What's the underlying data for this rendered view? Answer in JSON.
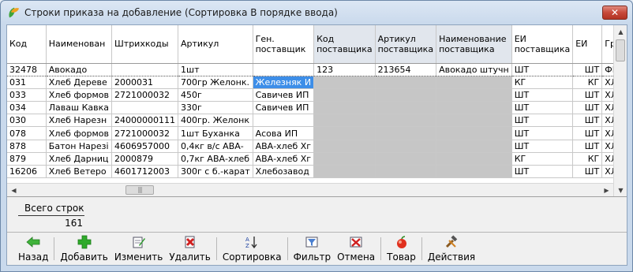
{
  "window": {
    "title": "Строки приказа на добавление (Сортировка В порядке ввода)",
    "close_label": "✕"
  },
  "grid": {
    "columns": [
      {
        "label": "Код",
        "w": 70,
        "sel": false
      },
      {
        "label": "Наименован",
        "w": 75,
        "sel": false
      },
      {
        "label": "Штрихкоды",
        "w": 76,
        "sel": false
      },
      {
        "label": "Артикул",
        "w": 82,
        "sel": false
      },
      {
        "label": "Ген. поставщик",
        "w": 73,
        "sel": false
      },
      {
        "label": "Код поставщика",
        "w": 75,
        "sel": true
      },
      {
        "label": "Артикул поставщика",
        "w": 77,
        "sel": true
      },
      {
        "label": "Наименование поставщика",
        "w": 87,
        "sel": true
      },
      {
        "label": "ЕИ поставщика",
        "w": 74,
        "sel": false
      },
      {
        "label": "ЕИ",
        "w": 68,
        "sel": false
      },
      {
        "label": "Гру",
        "w": 40,
        "sel": false
      }
    ],
    "rows": [
      [
        "32478",
        "Авокадо",
        "",
        "1шт",
        "",
        "123",
        "213654",
        "Авокадо штучн",
        "ШТ",
        "ШТ",
        "ФР"
      ],
      [
        "031",
        "Хлеб Дереве",
        "2000031",
        "700гр Желонк.",
        "Железняк И",
        "",
        "",
        "",
        "КГ",
        "КГ",
        "ХЛ"
      ],
      [
        "033",
        "Хлеб формов",
        "2721000032",
        "450г",
        "Савичев ИП",
        "",
        "",
        "",
        "ШТ",
        "ШТ",
        "ХЛ"
      ],
      [
        "034",
        "Лаваш Кавка",
        "",
        "330г",
        "Савичев ИП",
        "",
        "",
        "",
        "ШТ",
        "ШТ",
        "ХЛ"
      ],
      [
        "030",
        "Хлеб Нарезн",
        "24000000111",
        "400гр. Желонк",
        "",
        "",
        "",
        "",
        "ШТ",
        "ШТ",
        "ХЛ"
      ],
      [
        "078",
        "Хлеб формов",
        "2721000032",
        "1шт Буханка",
        "Асова ИП",
        "",
        "",
        "",
        "ШТ",
        "ШТ",
        "ХЛ"
      ],
      [
        "878",
        "Батон Нарезі",
        "4606957000",
        "0,4кг в/с АВА-",
        "АВА-хлеб Хг",
        "",
        "",
        "",
        "ШТ",
        "ШТ",
        "ХЛ"
      ],
      [
        "879",
        "Хлеб Дарниц",
        "2000879",
        "0,7кг АВА-хлеб",
        "АВА-хлеб Хг",
        "",
        "",
        "",
        "КГ",
        "КГ",
        "ХЛ"
      ],
      [
        "16206",
        "Хлеб Ветеро",
        "4601712003",
        "300г с б.-карат",
        "Хлебозавод",
        "",
        "",
        "",
        "ШТ",
        "ШТ",
        "ХЛ"
      ]
    ]
  },
  "totals": {
    "label": "Всего строк",
    "value": "161"
  },
  "toolbar": {
    "back": "Назад",
    "add": "Добавить",
    "edit": "Изменить",
    "delete": "Удалить",
    "sort": "Сортировка",
    "filter": "Фильтр",
    "cancel": "Отмена",
    "product": "Товар",
    "actions": "Действия"
  },
  "colors": {
    "selected_cell": "#3d8ee8",
    "supplier_cols": "#c6c6c6"
  }
}
